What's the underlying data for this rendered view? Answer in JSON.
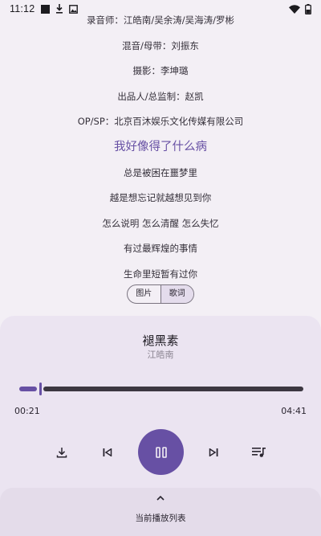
{
  "status_bar": {
    "time": "11:12",
    "icons": [
      "black-square-icon",
      "download-icon",
      "photo-icon",
      "wifi-icon",
      "battery-icon"
    ]
  },
  "lyrics": [
    "录音师：江皓南/吴余涛/吴海涛/罗彬",
    "混音/母带：刘振东",
    "摄影：李坤璐",
    "出品人/总监制：赵凯",
    "OP/SP：北京百沐娱乐文化传媒有限公司",
    "我好像得了什么病",
    "总是被困在噩梦里",
    "越是想忘记就越想见到你",
    "怎么说明 怎么清醒 怎么失忆",
    "有过最辉煌的事情",
    "生命里短暂有过你"
  ],
  "current_line_index": 5,
  "view_toggle": {
    "options": [
      "图片",
      "歌词"
    ],
    "selected": "歌词"
  },
  "player": {
    "title": "褪黑素",
    "artist": "江皓南",
    "elapsed": "00:21",
    "duration": "04:41",
    "progress": 0.0747,
    "controls": {
      "download": "download-icon",
      "previous": "skip-previous-icon",
      "play_pause": "pause-icon",
      "next": "skip-next-icon",
      "queue": "queue-music-icon"
    }
  },
  "queue_bar": {
    "label": "当前播放列表",
    "icon": "chevron-up-icon"
  },
  "colors": {
    "accent": "#6750a4",
    "background": "#f3eff5",
    "panel": "#ebe4f1"
  }
}
